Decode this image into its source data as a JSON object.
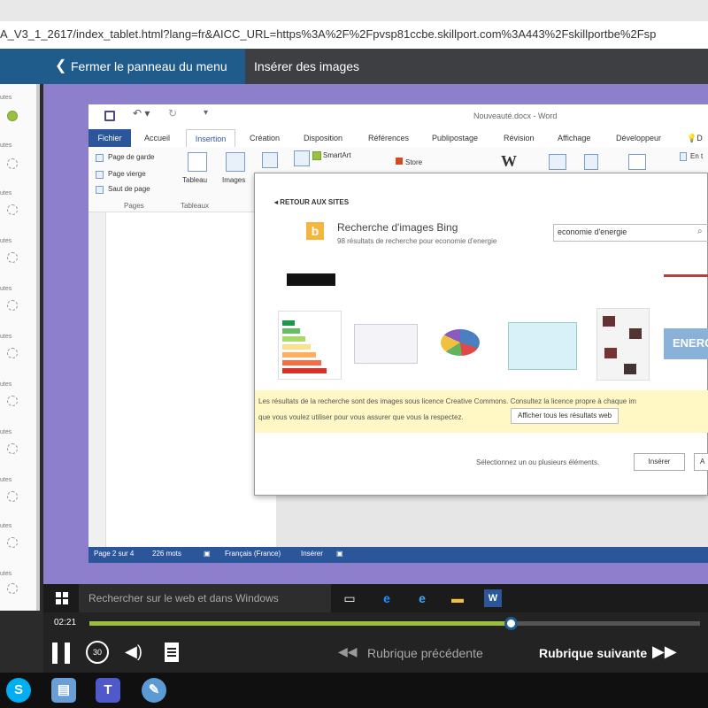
{
  "browser": {
    "url": "A_V3_1_2617/index_tablet.html?lang=fr&AICC_URL=https%3A%2F%2Fpvsp81ccbe.skillport.com%3A443%2Fskillportbe%2Fsp"
  },
  "nav": {
    "close_menu": "Fermer le panneau du menu",
    "title": "Insérer des images"
  },
  "sidebar": {
    "items": [
      "utes",
      "utes",
      "utes",
      "utes",
      "utes",
      "utes",
      "utes",
      "utes",
      "utes",
      "utes",
      "utes"
    ],
    "status_complete_color": "#9bc13c"
  },
  "word": {
    "doc_title": "Nouveauté.docx - Word",
    "tabs": [
      "Fichier",
      "Accueil",
      "Insertion",
      "Création",
      "Disposition",
      "Références",
      "Publipostage",
      "Révision",
      "Affichage",
      "Développeur",
      "D"
    ],
    "ribbon": {
      "page_de_garde": "Page de garde",
      "page_vierge": "Page vierge",
      "saut_de_page": "Saut de page",
      "pages_group": "Pages",
      "tableau": "Tableau",
      "tableaux_group": "Tableaux",
      "images": "Images",
      "smartart": "SmartArt",
      "store": "Store",
      "en_t": "En t"
    },
    "status": {
      "page": "Page 2 sur 4",
      "words": "226 mots",
      "language": "Français (France)",
      "mode": "Insérer"
    },
    "accent": "#2b579a"
  },
  "dialog": {
    "back": "RETOUR AUX SITES",
    "bing_title": "Recherche d'images Bing",
    "bing_sub": "98 résultats de recherche pour economie d'energie",
    "search_value": "economie d'energie",
    "thumb_label": "ENERG",
    "notice_line1": "Les résultats de la recherche sont des images sous licence Creative Commons. Consultez la licence propre à chaque im",
    "notice_line2": "que vous voulez utiliser pour vous assurer que vous la respectez.",
    "show_all": "Afficher tous les résultats web",
    "select_hint": "Sélectionnez un ou plusieurs éléments.",
    "insert": "Insérer",
    "cancel": "A"
  },
  "taskbar": {
    "search_placeholder": "Rechercher sur le web et dans Windows"
  },
  "player": {
    "time": "02:21",
    "progress": 0.69,
    "prev": "Rubrique précédente",
    "next": "Rubrique suivante",
    "rewind": "30"
  }
}
